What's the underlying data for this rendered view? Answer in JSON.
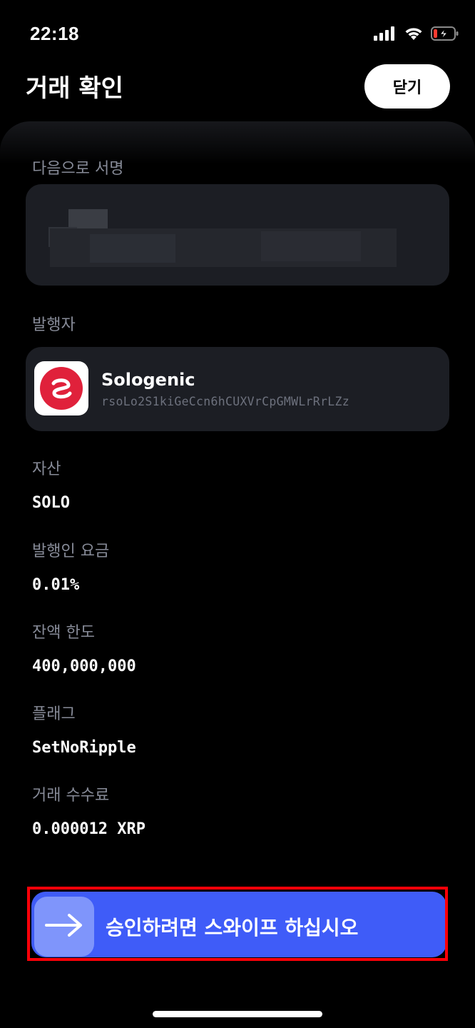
{
  "status_bar": {
    "time": "22:18",
    "icons": [
      "cellular-signal-icon",
      "wifi-icon",
      "battery-low-charging-icon"
    ]
  },
  "header": {
    "title": "거래 확인",
    "close_label": "닫기"
  },
  "signer": {
    "label": "다음으로 서명"
  },
  "issuer": {
    "label": "발행자",
    "name": "Sologenic",
    "address": "rsoLo2S1kiGeCcn6hCUXVrCpGMWLrRrLZz",
    "logo_icon": "sologenic-logo-icon"
  },
  "asset": {
    "label": "자산",
    "value": "SOLO"
  },
  "issuer_fee": {
    "label": "발행인 요금",
    "value": "0.01%"
  },
  "limit": {
    "label": "잔액 한도",
    "value": "400,000,000"
  },
  "flags": {
    "label": "플래그",
    "value": "SetNoRipple"
  },
  "tx_fee": {
    "label": "거래 수수료",
    "value": "0.000012 XRP"
  },
  "swipe": {
    "label": "승인하려면 스와이프 하십시오",
    "icon": "arrow-right-icon"
  },
  "colors": {
    "accent": "#3f5cf8",
    "handle": "#7f95fb",
    "card": "#1c1e24",
    "muted": "#878b98",
    "highlight": "#ff0008",
    "logo": "#e0213b"
  }
}
